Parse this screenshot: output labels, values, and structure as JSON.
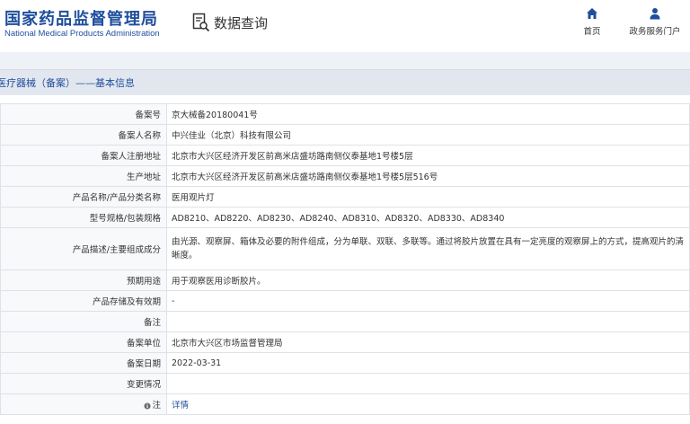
{
  "header": {
    "logo_cn": "国家药品监督管理局",
    "logo_en": "National Medical Products Administration",
    "query_label": "数据查询",
    "nav_home": "首页",
    "nav_portal": "政务服务门户"
  },
  "section": {
    "title": "医疗器械（备案）——基本信息"
  },
  "rows": [
    {
      "label": "备案号",
      "value": "京大械备20180041号"
    },
    {
      "label": "备案人名称",
      "value": "中兴佳业（北京）科技有限公司"
    },
    {
      "label": "备案人注册地址",
      "value": "北京市大兴区经济开发区前高米店盛坊路南侧仪泰基地1号楼5层"
    },
    {
      "label": "生产地址",
      "value": "北京市大兴区经济开发区前高米店盛坊路南侧仪泰基地1号楼5层516号"
    },
    {
      "label": "产品名称/产品分类名称",
      "value": "医用观片灯"
    },
    {
      "label": "型号规格/包装规格",
      "value": "AD8210、AD8220、AD8230、AD8240、AD8310、AD8320、AD8330、AD8340"
    },
    {
      "label": "产品描述/主要组成成分",
      "value": "由光源、观察屏、箱体及必要的附件组成，分为单联、双联、多联等。通过将胶片放置在具有一定亮度的观察屏上的方式，提高观片的清晰度。"
    },
    {
      "label": "预期用途",
      "value": "用于观察医用诊断胶片。"
    },
    {
      "label": "产品存储及有效期",
      "value": "-"
    },
    {
      "label": "备注",
      "value": ""
    },
    {
      "label": "备案单位",
      "value": "北京市大兴区市场监督管理局"
    },
    {
      "label": "备案日期",
      "value": "2022-03-31"
    },
    {
      "label": "变更情况",
      "value": ""
    },
    {
      "label": "注",
      "value": "详情"
    }
  ],
  "colors": {
    "brand_blue": "#1f4e9c",
    "section_bg": "#e2e7ef",
    "key_cell_bg": "#f7f9fb",
    "border": "#dde2ea"
  }
}
